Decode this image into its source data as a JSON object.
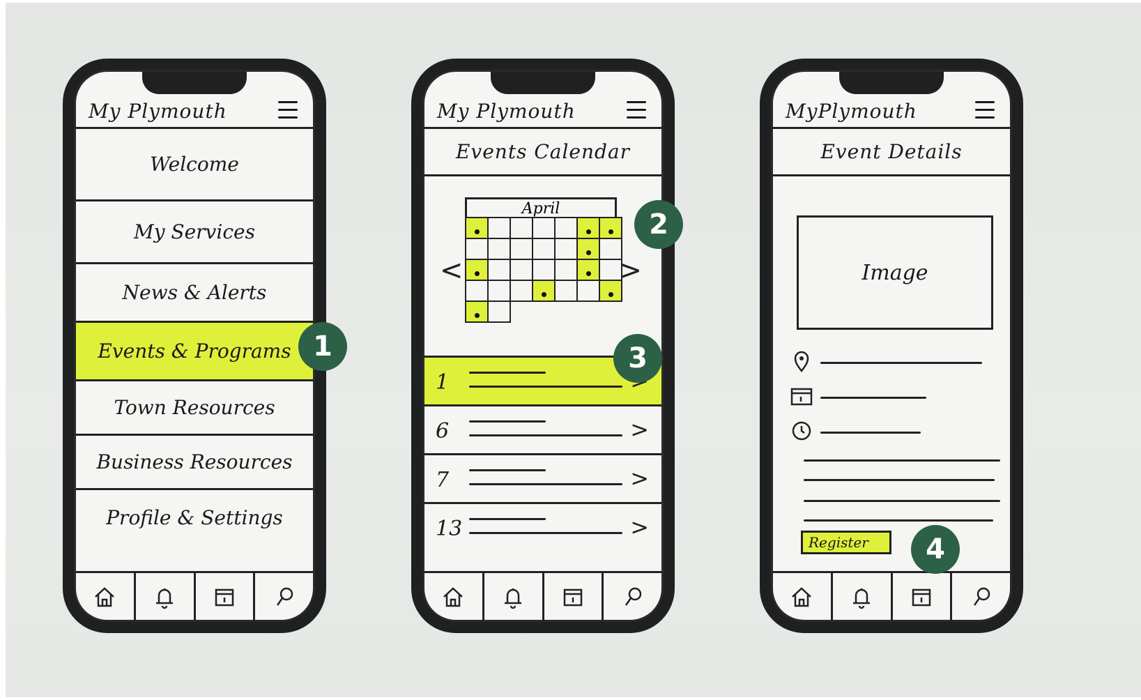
{
  "colors": {
    "highlight": "#dff03a",
    "badge": "#2c6147",
    "ink": "#1a1a1a"
  },
  "screens": [
    {
      "title": "My Plymouth",
      "menu_items": [
        "Welcome",
        "My Services",
        "News & Alerts",
        "Events & Programs",
        "Town Resources",
        "Business Resources",
        "Profile & Settings"
      ],
      "highlighted_item": "Events & Programs"
    },
    {
      "title": "My Plymouth",
      "section": "Events Calendar",
      "calendar": {
        "month": "April",
        "prev": "<",
        "next": ">"
      },
      "events": [
        {
          "day": "1",
          "chevron": ">"
        },
        {
          "day": "6",
          "chevron": ">"
        },
        {
          "day": "7",
          "chevron": ">"
        },
        {
          "day": "13",
          "chevron": ">"
        }
      ]
    },
    {
      "title": "MyPlymouth",
      "section": "Event Details",
      "image_label": "Image",
      "register_label": "Register"
    }
  ],
  "tab_icons": [
    "home-icon",
    "bell-icon",
    "calendar-icon",
    "search-icon"
  ],
  "badges": [
    "1",
    "2",
    "3",
    "4"
  ]
}
